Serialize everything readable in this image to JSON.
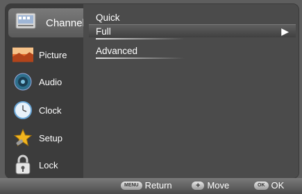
{
  "sidebar": {
    "items": [
      {
        "label": "Channel",
        "icon": "channel-icon"
      },
      {
        "label": "Picture",
        "icon": "picture-icon"
      },
      {
        "label": "Audio",
        "icon": "audio-icon"
      },
      {
        "label": "Clock",
        "icon": "clock-icon"
      },
      {
        "label": "Setup",
        "icon": "setup-icon"
      },
      {
        "label": "Lock",
        "icon": "lock-icon"
      }
    ]
  },
  "menu": {
    "items": [
      {
        "label": "Quick"
      },
      {
        "label": "Full",
        "arrow": "▶"
      },
      {
        "label": "Advanced"
      }
    ]
  },
  "footer": {
    "return_key": "MENU",
    "return_label": "Return",
    "move_key": "+",
    "move_label": "Move",
    "ok_key": "OK",
    "ok_label": "OK"
  }
}
